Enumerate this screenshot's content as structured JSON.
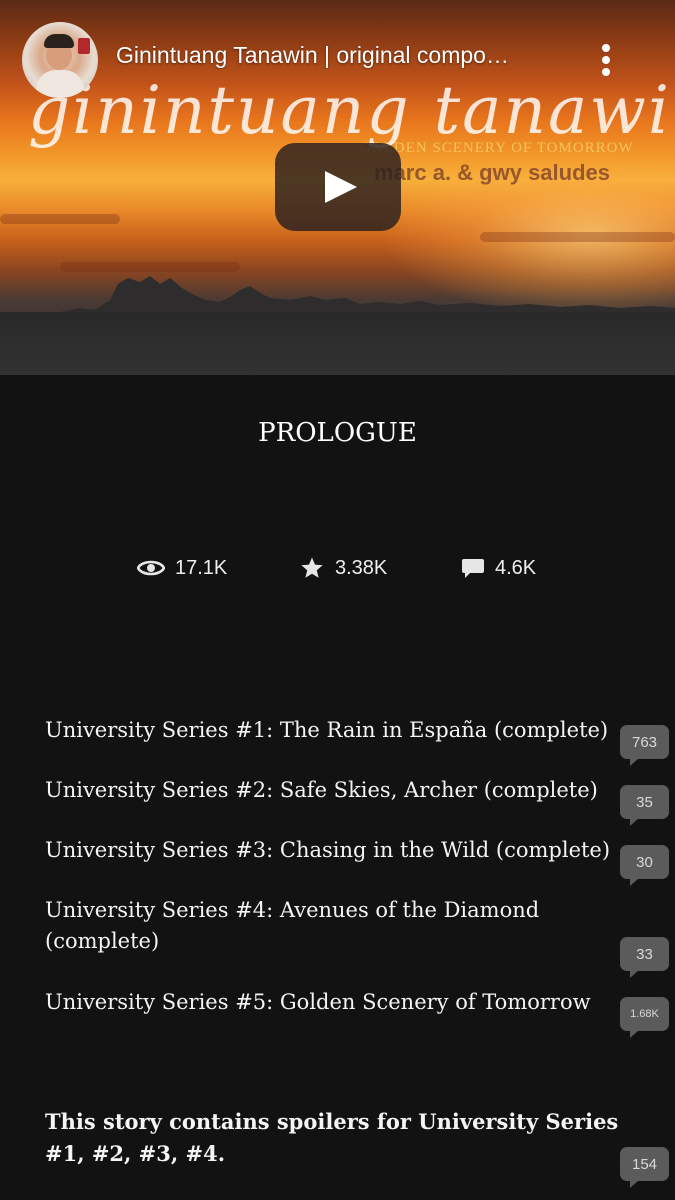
{
  "video": {
    "title": "Ginintuang Tanawin | original compo…",
    "thumbnail_title": "ginintuang tanawin",
    "thumbnail_subtitle": "GOLDEN SCENERY OF TOMORROW",
    "thumbnail_authors": "marc a. & gwy saludes",
    "icons": {
      "more": "more-vert-icon",
      "play": "play-icon"
    },
    "colors": {
      "play_bg": "#2a1e1e",
      "sky_top": "#5a2a16",
      "sky_glow": "#f7b03a"
    }
  },
  "chapter": {
    "title": "PROLOGUE"
  },
  "stats": {
    "reads": "17.1K",
    "votes": "3.38K",
    "comments": "4.6K"
  },
  "list": [
    {
      "text": "University Series #1: The Rain in España (complete)",
      "comments": "763"
    },
    {
      "text": "University Series #2: Safe Skies, Archer (complete)",
      "comments": "35"
    },
    {
      "text": "University Series #3: Chasing in the Wild (complete)",
      "comments": "30"
    },
    {
      "text": "University Series #4: Avenues of the Diamond (complete)",
      "comments": "33"
    },
    {
      "text": "University Series #5: Golden Scenery of Tomorrow",
      "comments": "1.68K"
    }
  ],
  "spoiler": {
    "text": "This story contains spoilers for University Series #1, #2, #3, #4.",
    "comments": "154"
  },
  "theme": {
    "background": "#121212",
    "bubble": "#5b5b5b",
    "text": "#f4f4f4"
  }
}
